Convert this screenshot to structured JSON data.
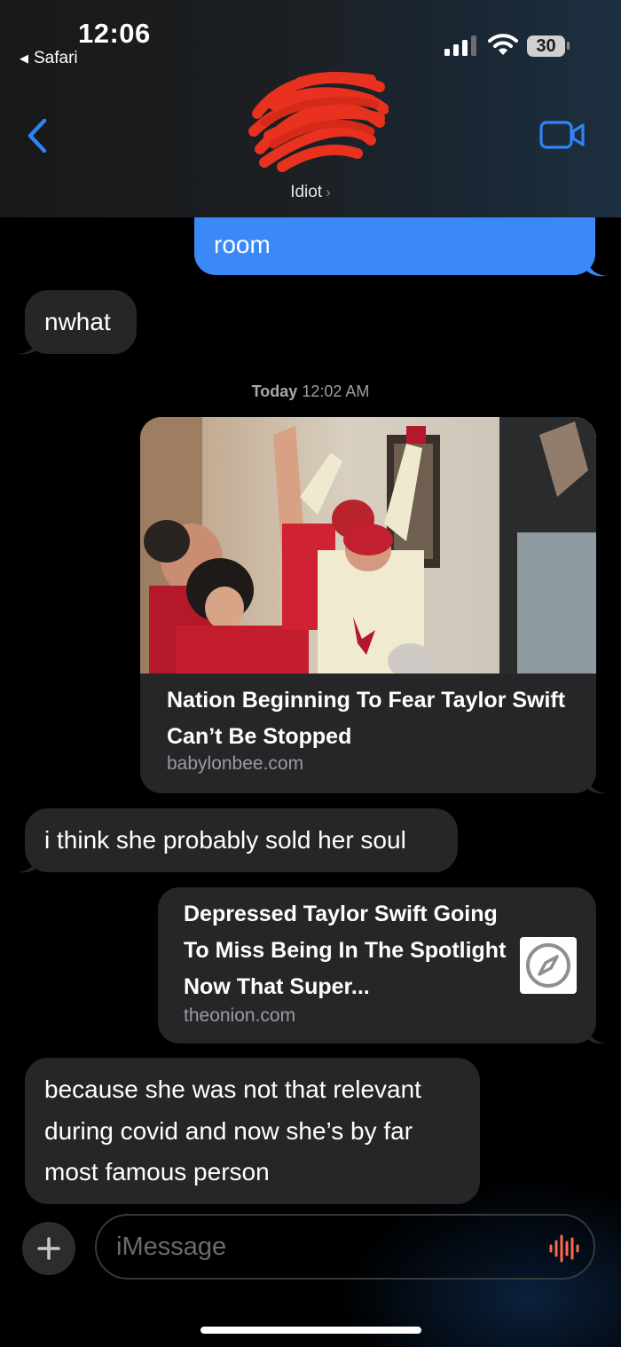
{
  "status_bar": {
    "time": "12:06",
    "back_app": "Safari",
    "battery": "30"
  },
  "header": {
    "contact_name": "Idiot",
    "contact_chevron": "›",
    "back_icon": "chevron-left-icon",
    "video_icon": "video-camera-icon"
  },
  "messages": {
    "out_1": "room",
    "in_1": "nwhat",
    "timestamp_day": "Today",
    "timestamp_time": "12:02 AM",
    "link_1": {
      "title": "Nation Beginning To Fear Taylor Swift Can’t Be Stopped",
      "domain": "babylonbee.com"
    },
    "in_2": "i think she probably sold her soul",
    "link_2": {
      "title": "Depressed Taylor Swift Going To Miss Being In The Spotlight Now That Super...",
      "domain": "theonion.com",
      "icon": "compass-icon"
    },
    "in_3": "because she was not that relevant during covid and now she’s by far most famous person"
  },
  "composer": {
    "placeholder": "iMessage",
    "plus_icon": "plus-icon",
    "audio_icon": "waveform-icon"
  },
  "colors": {
    "outgoing_bubble": "#3a89f7",
    "incoming_bubble": "#262628",
    "ios_blue": "#2f84f5",
    "waveform": "#ff6a4d"
  }
}
